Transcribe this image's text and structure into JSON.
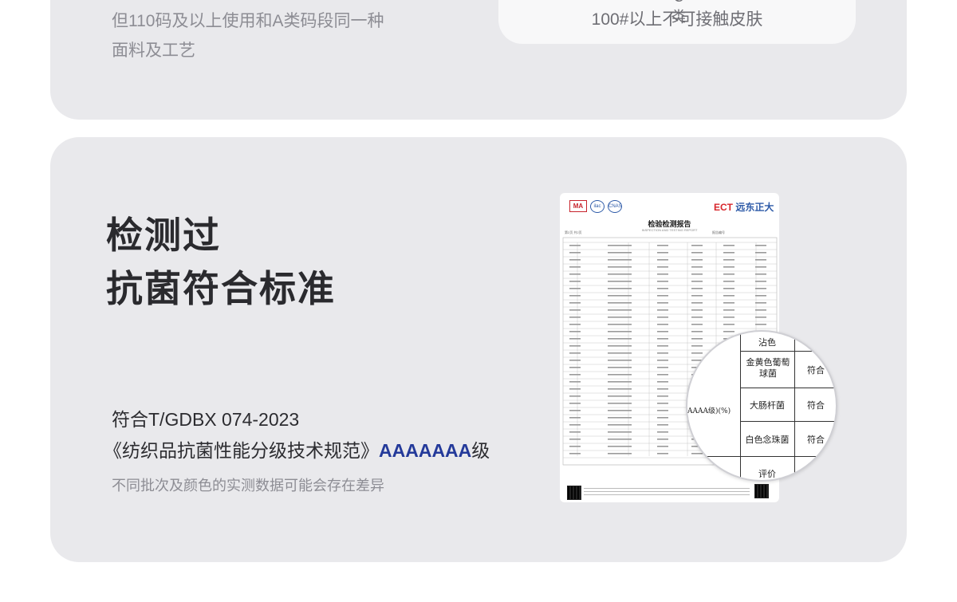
{
  "top_section": {
    "text_line_1": "但110码及以上使用和A类码段同一种",
    "text_line_2": "面料及工艺",
    "pill_fragment": "C类",
    "pill_text": "100#以上不可接触皮肤"
  },
  "antibacterial_section": {
    "headline_line_1": "检测过",
    "headline_line_2": "抗菌符合标准",
    "standard_line_1": "符合T/GDBX 074-2023",
    "standard_line_2_prefix": "《纺织品抗菌性能分级技术规范》",
    "standard_grade": "AAAAAAA",
    "standard_grade_suffix": "级",
    "note": "不同批次及颜色的实测数据可能会存在差异"
  },
  "report": {
    "logo_ma": "MA",
    "logo_2": "ilac",
    "logo_3": "CNAS",
    "brand_latin": "ECT",
    "brand_cn": "远东正大",
    "title": "检验检测报告",
    "subtitle": "INSPECTION AND TESTING REPORT",
    "page_no": "第2页 共2页",
    "report_no": "报告编号"
  },
  "magnifier": {
    "row_top": "沾色",
    "row_1": "金黄色葡萄球菌",
    "row_2": "大肠杆菌",
    "row_3": "白色念珠菌",
    "row_bottom": "评价",
    "result_1": "符合",
    "result_2": "符合",
    "result_3": "符合",
    "left_label": "AAAA级)(%)"
  }
}
